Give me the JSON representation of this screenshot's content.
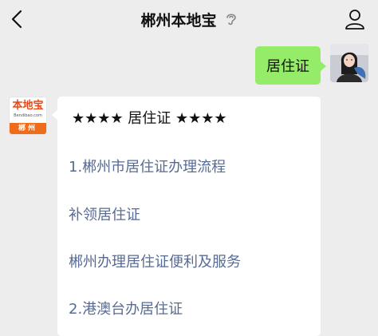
{
  "header": {
    "title": "郴州本地宝",
    "back_icon": "chevron-left-icon",
    "mute_icon": "ear-icon",
    "profile_icon": "person-icon"
  },
  "outgoing": {
    "text": "居住证",
    "bubble_color": "#95ec69"
  },
  "bot": {
    "avatar_main": "本地宝",
    "avatar_sub": "Bendibao.com",
    "avatar_city": "郴州",
    "brand_color": "#ef6c1a"
  },
  "card": {
    "header": "★★★★ 居住证 ★★★★",
    "links": [
      "1.郴州市居住证办理流程",
      "补领居住证",
      "郴州办理居住证便利及服务",
      "2.港澳台办居住证"
    ],
    "link_color": "#576b95"
  }
}
